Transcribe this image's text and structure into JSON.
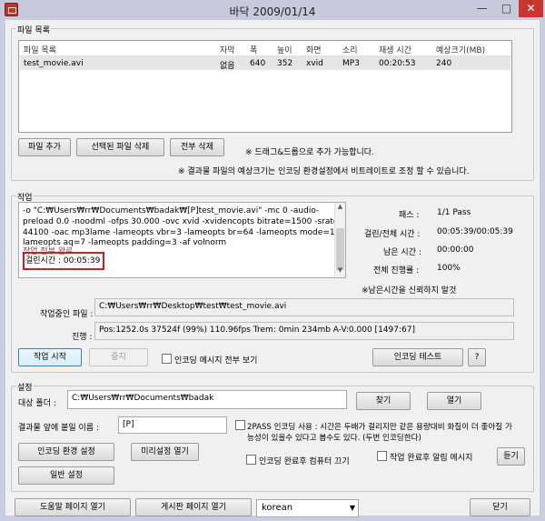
{
  "window": {
    "title": "바닥 2009/01/14",
    "min_label": "—",
    "max_label": "□",
    "close_label": "✕"
  },
  "file_list": {
    "group_label": "파일 목록",
    "columns": [
      "파일 목록",
      "자막",
      "폭",
      "높이",
      "화면",
      "소리",
      "재생 시간",
      "예상크기(MB)"
    ],
    "rows": [
      [
        "test_movie.avi",
        "없음",
        "640",
        "352",
        "xvid",
        "MP3",
        "00:20:53",
        "240"
      ]
    ],
    "add_file": "파일 추가",
    "delete_selected": "선택된 파일 삭제",
    "delete_all": "전부 삭제",
    "note_drag": "※ 드래그&드롭으로 추가 가능합니다.",
    "note_size": "※ 결과물 파일의 예상크기는 인코딩 환경설정에서 비트레이트로 조정 할 수 있습니다."
  },
  "work": {
    "group_label": "작업",
    "log_lines": [
      "-o \"C:₩Users₩rr₩Documents₩badak₩[P]test_movie.avi\" -mc 0 -audio-",
      "preload 0.0 -noodml -ofps 30.000 -ovc xvid -xvidencopts bitrate=1500 -srate",
      "44100 -oac mp3lame -lameopts vbr=3  -lameopts br=64 -lameopts mode=1 -",
      "lameopts aq=7 -lameopts padding=3 -af volnorm",
      "작업 전부 완료"
    ],
    "elapsed_line": "걸린시간 : 00:05:39",
    "pass_label": "패스 :",
    "pass_value": "1/1 Pass",
    "elapsed_total_label": "걸린/전체 시간 :",
    "elapsed_total_value": "00:05:39/00:05:39",
    "remaining_label": "남은 시간 :",
    "remaining_value": "00:00:00",
    "overall_label": "전체 진행률 :",
    "overall_value": "100%",
    "remaining_note": "※남은시간을 신뢰하지 말것",
    "current_file_label": "작업중인 파일 :",
    "current_file_value": "C:₩Users₩rr₩Desktop₩test₩test_movie.avi",
    "progress_label": "진행 :",
    "progress_value": "Pos:1252.0s  37524f (99%) 110.96fps Trem:   0min 234mb  A-V:0.000 [1497:67]",
    "start_button": "작업 시작",
    "stop_button": "중지",
    "show_all_msgs": "인코딩 메시지 전부 보기",
    "encoding_test": "인코딩 테스트",
    "help_button": "?"
  },
  "settings": {
    "group_label": "설정",
    "target_folder_label": "대상 폴더 :",
    "target_folder_value": "C:₩Users₩rr₩Documents₩badak",
    "find_button": "찾기",
    "open_button": "열기",
    "prefix_label": "결과물 앞에 붙일 이름 :",
    "prefix_value": "[P]",
    "twopass_text_line1": "2PASS 인코딩 사용 : 시간은 두배가 걸리지만 같은 용량대비 화질이 더 좋아질 가",
    "twopass_text_line2": "능성이 있을수 있다고 봅수도 있다. (두번 인코딩한다)",
    "encoding_settings": "인코딩 환경 설정",
    "preset_open": "미리설정 열기",
    "shutdown_after": "인코딩 완료후 컴퓨터 끄기",
    "alarm_after": "작업 완료후 알림 메시지",
    "listen_button": "듣기",
    "general_settings": "일반 설정"
  },
  "footer": {
    "help_page": "도움말 페이지 열기",
    "board_page": "게시판 페이지 열기",
    "language_value": "korean",
    "close_button": "닫기"
  }
}
